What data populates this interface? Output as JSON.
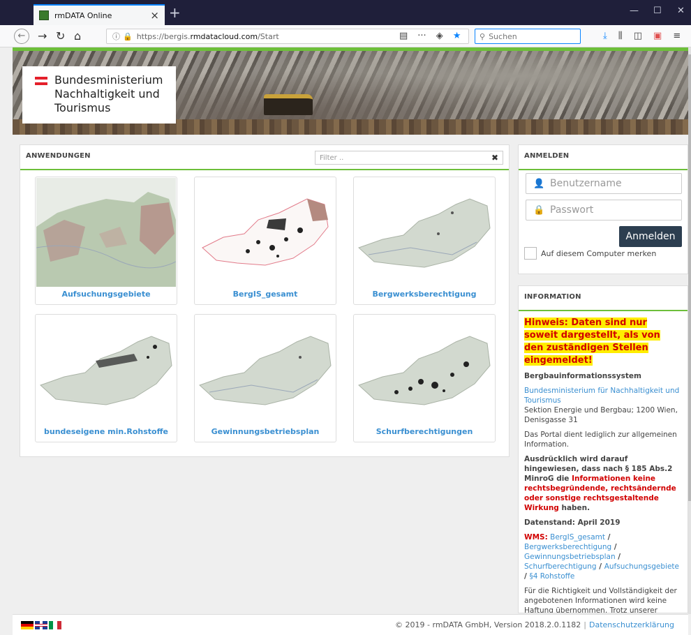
{
  "browser": {
    "tab_title": "rmDATA Online",
    "tab_close": "×",
    "new_tab": "+",
    "url_prefix": "https://bergis.",
    "url_domain": "rmdatacloud.com",
    "url_path": "/Start",
    "search_placeholder": "Suchen"
  },
  "banner": {
    "logo_line1": "Bundesministerium",
    "logo_line2": "Nachhaltigkeit und",
    "logo_line3": "Tourismus"
  },
  "apps": {
    "header": "ANWENDUNGEN",
    "filter_placeholder": "Filter ..",
    "filter_clear": "✖",
    "cards": [
      {
        "title": "Aufsuchungsgebiete"
      },
      {
        "title": "BergIS_gesamt"
      },
      {
        "title": "Bergwerksberechtigung"
      },
      {
        "title": "bundeseigene min.Rohstoffe"
      },
      {
        "title": "Gewinnungsbetriebsplan"
      },
      {
        "title": "Schurfberechtigungen"
      }
    ]
  },
  "login": {
    "header": "ANMELDEN",
    "username_placeholder": "Benutzername",
    "password_placeholder": "Passwort",
    "submit": "Anmelden",
    "remember": "Auf diesem Computer merken"
  },
  "info": {
    "header": "INFORMATION",
    "hinweis": "Hinweis: Daten sind nur soweit dargestellt, als von den zuständigen Stellen eingemeldet!",
    "system": "Bergbauinformationssystem",
    "ministry_link": "Bundesministerium für Nachhaltigkeit und Tourismus",
    "address": "Sektion Energie und Bergbau; 1200 Wien, Denisgasse 31",
    "portal": "Das Portal dient lediglich zur allgemeinen Information.",
    "notice_a": "Ausdrücklich wird darauf hingewiesen, dass nach § 185 Abs.2 MinroG die ",
    "notice_red": "Informationen keine rechtsbegründende, rechtsändernde oder sonstige rechtsgestaltende Wirkung",
    "notice_b": " haben.",
    "datenstand": "Datenstand: April 2019",
    "wms_label": "WMS:",
    "wms_links": [
      "BergIS_gesamt",
      "Bergwerksberechtigung",
      "Gewinnungsbetriebsplan",
      "Schurfberechtigung",
      "Aufsuchungsgebiete",
      "§4 Rohstoffe"
    ],
    "wms_sep": " / ",
    "disclaimer": "Für die Richtigkeit und Vollständigkeit der angebotenen Informationen wird keine Haftung übernommen. Trotz unserer Bemühungen kann keine Gewähr für die"
  },
  "footer": {
    "copyright": "© 2019 - rmDATA GmbH, Version 2018.2.0.1182",
    "separator": "|",
    "privacy": "Datenschutzerklärung"
  }
}
